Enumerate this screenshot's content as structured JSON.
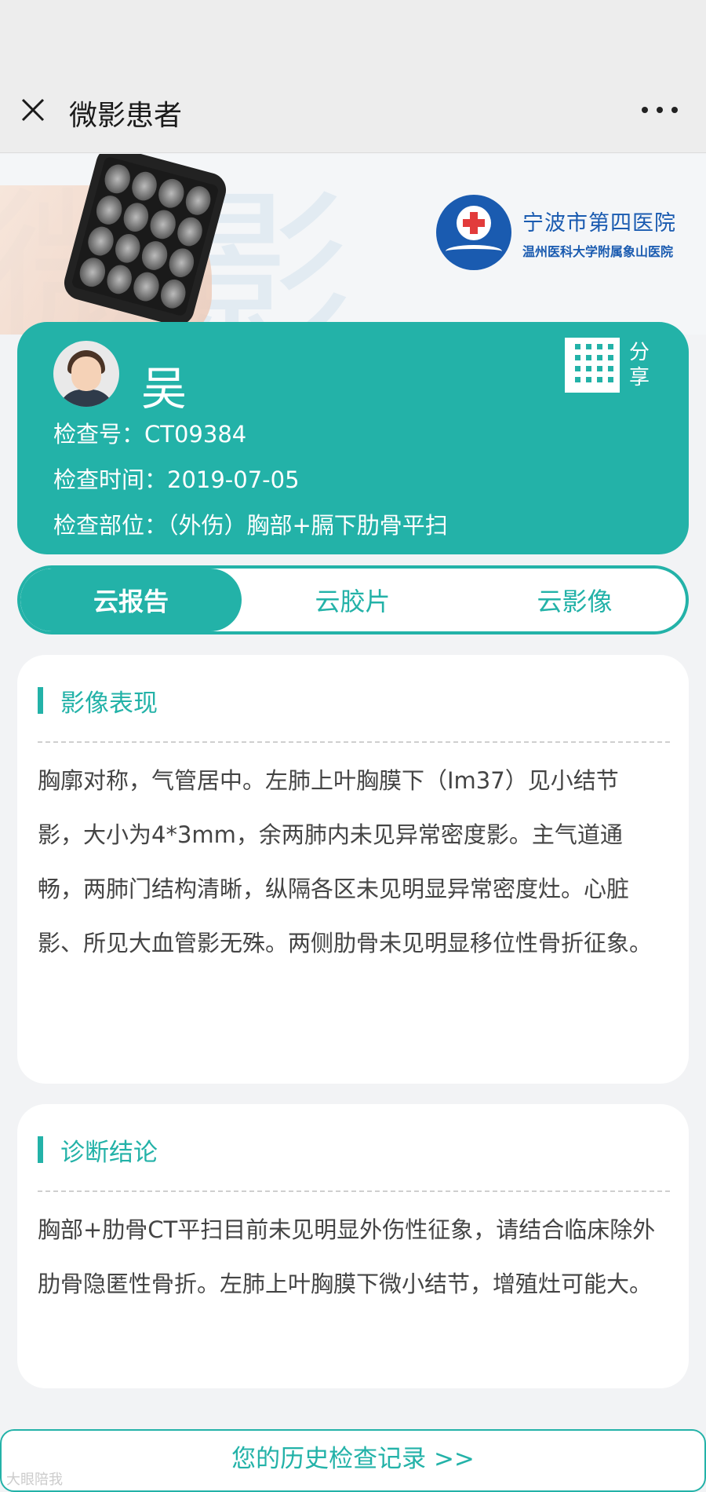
{
  "topbar": {
    "title": "微影患者",
    "close_icon": "close-icon",
    "more_icon": "more-horizontal-icon"
  },
  "hero": {
    "watermark": "微影",
    "hospital_name": "宁波市第四医院",
    "hospital_subname": "温州医科大学附属象山医院"
  },
  "patient": {
    "name": "吴",
    "exam_no": "检查号：CT09384",
    "exam_time": "检查时间：2019-07-05",
    "exam_part": "检查部位：（外伤）胸部+膈下肋骨平扫",
    "share_label": "分享"
  },
  "tabs": [
    {
      "label": "云报告",
      "active": true
    },
    {
      "label": "云胶片",
      "active": false
    },
    {
      "label": "云影像",
      "active": false
    }
  ],
  "findings": {
    "title": "影像表现",
    "body": "胸廓对称，气管居中。左肺上叶胸膜下（Im37）见小结节影，大小为4*3mm，余两肺内未见异常密度影。主气道通畅，两肺门结构清晰，纵隔各区未见明显异常密度灶。心脏影、所见大血管影无殊。两侧肋骨未见明显移位性骨折征象。"
  },
  "conclusion": {
    "title": "诊断结论",
    "body": "胸部+肋骨CT平扫目前未见明显外伤性征象，请结合临床除外肋骨隐匿性骨折。左肺上叶胸膜下微小结节，增殖灶可能大。"
  },
  "history_button": "您的历史检查记录 >>",
  "watermark_bottom": "大眼陪我",
  "colors": {
    "accent": "#23b2a8",
    "hospital_blue": "#1a5bb0"
  }
}
